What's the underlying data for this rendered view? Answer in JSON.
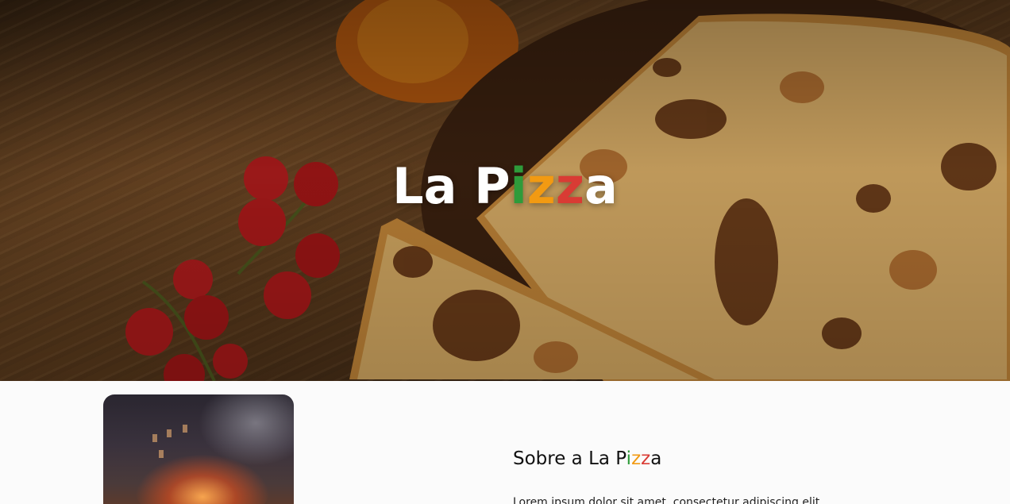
{
  "hero": {
    "title_parts": {
      "p1": "La P",
      "p2": "i",
      "p3": "z",
      "p4": "z",
      "p5": "a"
    },
    "accent_colors": {
      "green": "#2e9b3a",
      "orange": "#f29a12",
      "red": "#d93b34"
    }
  },
  "about": {
    "title_parts": {
      "p1": "Sobre a La P",
      "p2": "i",
      "p3": "z",
      "p4": "z",
      "p5": "a"
    },
    "text": "Lorem ipsum dolor sit amet, consectetur adipiscing elit"
  }
}
